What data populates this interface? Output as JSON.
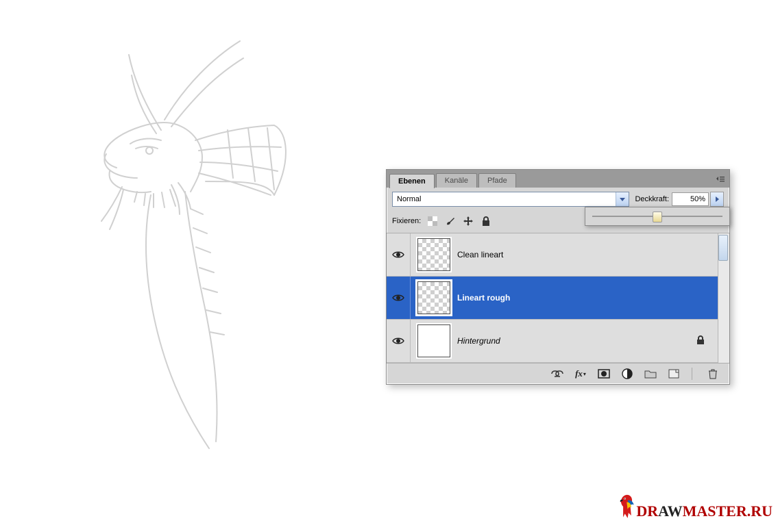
{
  "tabs": {
    "layers": "Ebenen",
    "channels": "Kanäle",
    "paths": "Pfade"
  },
  "blend": {
    "mode": "Normal",
    "opacity_label": "Deckkraft:",
    "opacity_value": "50%",
    "slider_percent": 50
  },
  "lock": {
    "label": "Fixieren:"
  },
  "layers": [
    {
      "name": "Clean lineart",
      "selected": false,
      "bg": "checker",
      "italic": false,
      "locked": false
    },
    {
      "name": "Lineart rough",
      "selected": true,
      "bg": "checker",
      "italic": false,
      "locked": false
    },
    {
      "name": "Hintergrund",
      "selected": false,
      "bg": "white",
      "italic": true,
      "locked": true
    }
  ],
  "watermark": {
    "pre": "DR",
    "mid": "AW",
    "post": "MASTER.RU"
  }
}
